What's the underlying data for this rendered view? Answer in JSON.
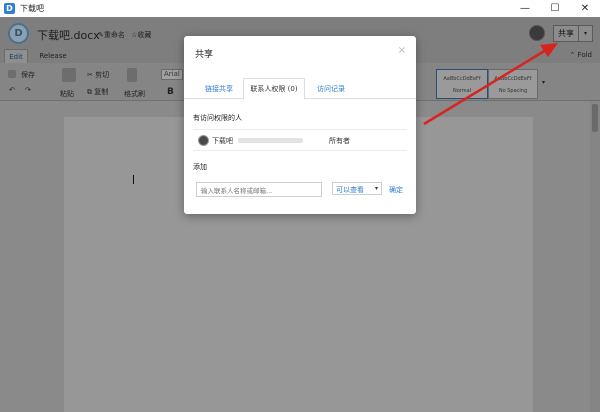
{
  "window": {
    "title": "下载吧",
    "app_icon_letter": "D",
    "controls": [
      "—",
      "☐",
      "✕"
    ]
  },
  "document": {
    "name": "下载吧.docx",
    "rename": "✎重命名",
    "favorite": "☆收藏",
    "logo_letter": "D"
  },
  "header": {
    "share_label": "共享",
    "share_caret": "▾"
  },
  "ribbon_tabs": {
    "edit": "Edit",
    "release": "Release",
    "fold": "⌃ Fold"
  },
  "ribbon": {
    "save": "保存",
    "paste": "粘贴",
    "cut": "剪切",
    "copy": "复制",
    "format_painter": "格式刷",
    "font": "Arial",
    "bold": "B",
    "style_normal_preview": "AaBbCcDdEeFf",
    "style_normal": "Normal",
    "style_nospacing_preview": "AaBbCcDdEeFf",
    "style_nospacing": "No Spacing"
  },
  "modal": {
    "title": "共享",
    "close": "×",
    "tabs": {
      "link_share": "链接共享",
      "contact_permissions": "联系人权限 (0)",
      "access_log": "访问记录"
    },
    "access_section": "有访问权限的人",
    "owner": {
      "name": "下载吧",
      "role": "所有者"
    },
    "add_section": "添加",
    "add_placeholder": "输入联系人名称或邮箱...",
    "permission": "可以查看",
    "permission_caret": "▾",
    "confirm": "确定"
  },
  "colors": {
    "accent": "#2e7bcf",
    "arrow": "#d9231f"
  }
}
